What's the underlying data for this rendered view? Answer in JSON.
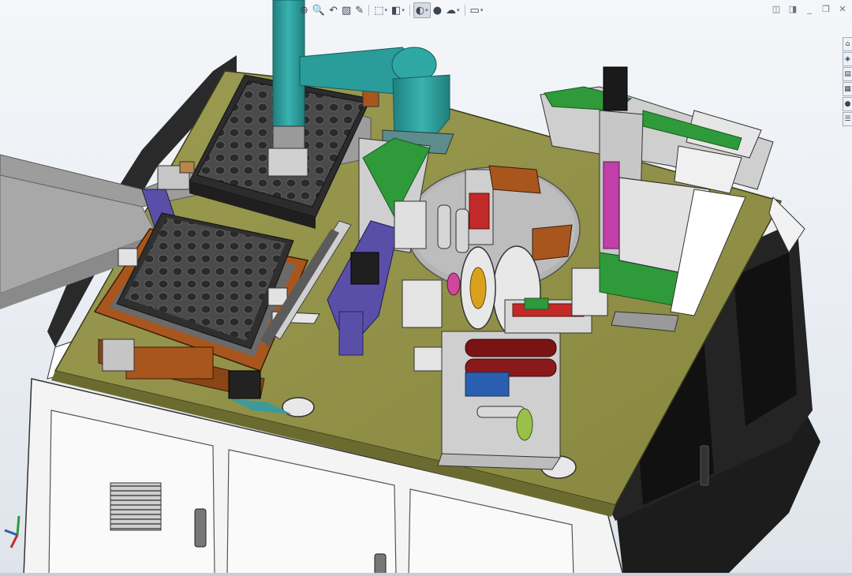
{
  "app": {
    "view": "isometric-assembly"
  },
  "heads_up_toolbar": {
    "buttons": [
      {
        "name": "zoom-to-fit-icon",
        "glyph": "⊕",
        "dropdown": false
      },
      {
        "name": "zoom-area-icon",
        "glyph": "🔍",
        "dropdown": false
      },
      {
        "name": "previous-view-icon",
        "glyph": "↶",
        "dropdown": false
      },
      {
        "name": "section-view-icon",
        "glyph": "▧",
        "dropdown": false
      },
      {
        "name": "dynamic-annotation-icon",
        "glyph": "✎",
        "dropdown": false
      },
      {
        "name": "view-orientation-icon",
        "glyph": "⬚",
        "dropdown": true
      },
      {
        "name": "display-style-icon",
        "glyph": "◧",
        "dropdown": true
      },
      {
        "name": "hide-show-items-icon",
        "glyph": "◐",
        "dropdown": true,
        "active": true
      },
      {
        "name": "edit-appearance-icon",
        "glyph": "●",
        "dropdown": false
      },
      {
        "name": "apply-scene-icon",
        "glyph": "☁",
        "dropdown": true
      },
      {
        "name": "view-settings-icon",
        "glyph": "▭",
        "dropdown": true
      }
    ]
  },
  "window_controls": [
    {
      "name": "tile-horizontal-icon",
      "glyph": "◫"
    },
    {
      "name": "tile-vertical-icon",
      "glyph": "◨"
    },
    {
      "name": "minimize-icon",
      "glyph": "_"
    },
    {
      "name": "restore-icon",
      "glyph": "❐"
    },
    {
      "name": "close-icon",
      "glyph": "✕"
    }
  ],
  "task_pane_tabs": [
    {
      "name": "resources-tab-icon",
      "glyph": "⌂"
    },
    {
      "name": "design-library-tab-icon",
      "glyph": "◈"
    },
    {
      "name": "file-explorer-tab-icon",
      "glyph": "▤"
    },
    {
      "name": "view-palette-tab-icon",
      "glyph": "▦"
    },
    {
      "name": "appearances-tab-icon",
      "glyph": "●"
    },
    {
      "name": "custom-properties-tab-icon",
      "glyph": "☰"
    }
  ],
  "colors": {
    "deck": "#8f8f48",
    "cabinet": "#f7f7f7",
    "frame": "#2b2b2b",
    "robot_arm": "#2a9c9a",
    "tray": "#3a3a3a",
    "rust_plate": "#a8561e",
    "green_parts": "#2e9a3a",
    "purple_parts": "#5a4fa8",
    "conveyor": "#9a9a9a"
  }
}
